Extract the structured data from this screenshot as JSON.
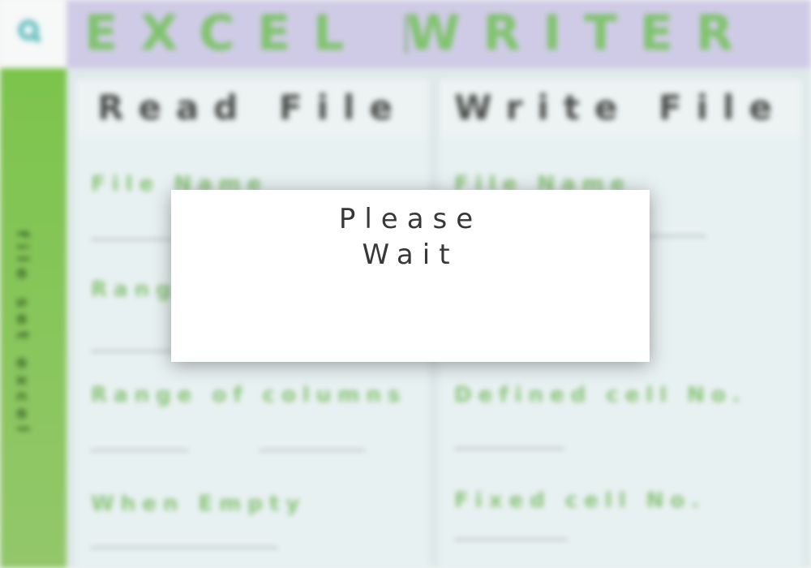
{
  "app": {
    "title": "EXCEL WRITER"
  },
  "sidebar": {
    "vertical_text": "file set excel"
  },
  "read_panel": {
    "title": "Read File",
    "fields": {
      "file_name": "File Name",
      "range": "Range",
      "range_of_columns": "Range of columns",
      "when_empty": "When Empty"
    }
  },
  "write_panel": {
    "title": "Write File",
    "fields": {
      "file_name": "File Name",
      "defined_cell": "Defined cell No.",
      "fixed_cell": "Fixed cell No."
    }
  },
  "modal": {
    "line1": "Please",
    "line2": "Wait"
  },
  "colors": {
    "header_bg": "#cfcbe6",
    "sidebar_green": "#7cc44c",
    "accent_green": "#8ac479",
    "modal_text": "#383838"
  },
  "icons": {
    "logo": "search-logo-icon"
  }
}
